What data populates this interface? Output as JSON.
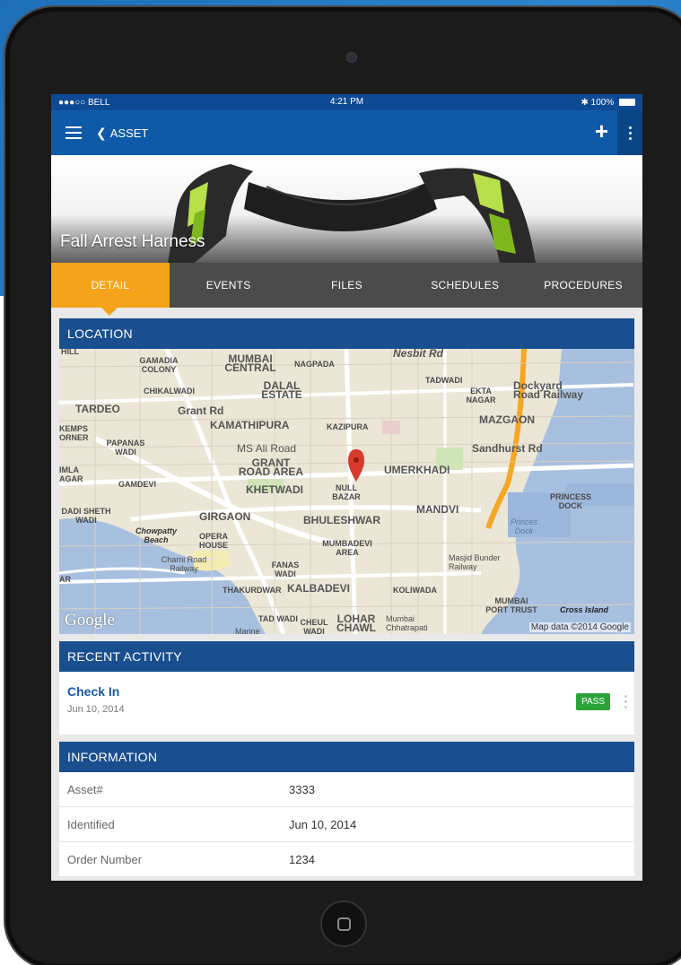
{
  "status_bar": {
    "carrier": "●●●○○ BELL",
    "time": "4:21 PM",
    "battery": "100%"
  },
  "app_bar": {
    "back_label": "ASSET",
    "add_symbol": "+",
    "menu_icon": "hamburger-icon",
    "more_icon": "vertical-dots-icon"
  },
  "hero": {
    "title": "Fall Arrest Harness"
  },
  "tabs": [
    {
      "label": "DETAIL",
      "active": true
    },
    {
      "label": "EVENTS",
      "active": false
    },
    {
      "label": "FILES",
      "active": false
    },
    {
      "label": "SCHEDULES",
      "active": false
    },
    {
      "label": "PROCEDURES",
      "active": false
    }
  ],
  "location": {
    "header": "LOCATION",
    "map_labels": {
      "hill": "HILL",
      "gamadia_colony": "GAMADIA COLONY",
      "mumbai_central": "MUMBAI CENTRAL",
      "nagpada": "NAGPADA",
      "nesbit_rd": "Nesbit Rd",
      "tadwadi": "TADWADI",
      "chikalwadi": "CHIKALWADI",
      "dalal_estate": "DALAL ESTATE",
      "ekta_nagar": "EKTA NAGAR",
      "dockyard": "Dockyard Road Railway",
      "tardeo": "TARDEO",
      "grant_rd": "Grant Rd",
      "kamathipura": "KAMATHIPURA",
      "kazipura": "KAZIPURA",
      "mazgaon": "MAZGAON",
      "kemps_corner": "KEMPS ORNER",
      "papanas_wadi": "PAPANAS WADI",
      "ms_ali_road": "MS Ali Road",
      "sandhurst_rd": "Sandhurst Rd",
      "grant_road_area": "GRANT ROAD AREA",
      "umerkhadi": "UMERKHADI",
      "imla_agar": "IMLA AGAR",
      "gamdevi": "GAMDEVI",
      "khetwadi": "KHETWADI",
      "null_bazar": "NULL BAZAR",
      "princess_dock": "PRINCESS DOCK",
      "dadi_sheth_wadi": "DADI SHETH WADI",
      "girgaon": "GIRGAON",
      "bhuleshwar": "BHULESHWAR",
      "mandvi": "MANDVI",
      "princes_dock": "Princes Dock",
      "chowpatty_beach": "Chowpatty Beach",
      "opera_house": "OPERA HOUSE",
      "mumbadevi_area": "MUMBADEVI AREA",
      "charni_road": "Charni Road Railway",
      "fanas_wadi": "FANAS WADI",
      "masjid_bunder": "Masjid Bunder Railway",
      "ar": "AR",
      "thakurdwar": "THAKURDWAR",
      "kalbadevi": "KALBADEVI",
      "koliwada": "KOLIWADA",
      "mumbai_port_trust": "MUMBAI PORT TRUST",
      "cross_island": "Cross Island",
      "tad_wadi": "TAD WADI",
      "cheul_wadi": "CHEUL WADI",
      "lohar_chawl": "LOHAR CHAWL",
      "mumbai_chhatrapati": "Mumbai Chhatrapati",
      "marine": "Marine"
    },
    "google_label": "Google",
    "map_data": "Map data ©2014 Google"
  },
  "recent_activity": {
    "header": "RECENT ACTIVITY",
    "items": [
      {
        "title": "Check In",
        "date": "Jun 10, 2014",
        "status": "PASS"
      }
    ]
  },
  "information": {
    "header": "INFORMATION",
    "rows": [
      {
        "label": "Asset#",
        "value": "3333"
      },
      {
        "label": "Identified",
        "value": "Jun 10, 2014"
      },
      {
        "label": "Order Number",
        "value": "1234"
      }
    ]
  },
  "colors": {
    "primary": "#0f5aa8",
    "header": "#1a4f8f",
    "accent": "#f5a31a",
    "pass": "#2ca33a"
  }
}
